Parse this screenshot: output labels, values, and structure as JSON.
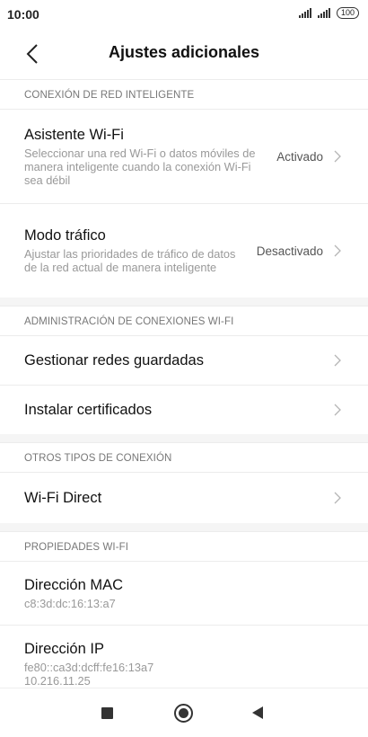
{
  "status_bar": {
    "time": "10:00",
    "battery": "100"
  },
  "header": {
    "title": "Ajustes adicionales"
  },
  "sections": {
    "smart": {
      "title": "CONEXIÓN DE RED INTELIGENTE",
      "wifi_assistant": {
        "title": "Asistente Wi-Fi",
        "subtitle": "Seleccionar una red Wi-Fi o datos móviles de manera inteligente cuando la conexión Wi-Fi sea débil",
        "value": "Activado"
      },
      "traffic_mode": {
        "title": "Modo tráfico",
        "subtitle": "Ajustar las prioridades de tráfico de datos de la red actual de manera inteligente",
        "value": "Desactivado"
      }
    },
    "wifi_admin": {
      "title": "ADMINISTRACIÓN DE CONEXIONES WI-FI",
      "saved_networks": "Gestionar redes guardadas",
      "install_certs": "Instalar certificados"
    },
    "other": {
      "title": "OTROS TIPOS DE CONEXIÓN",
      "wifi_direct": "Wi-Fi Direct"
    },
    "props": {
      "title": "PROPIEDADES WI-FI",
      "mac": {
        "title": "Dirección MAC",
        "value": "c8:3d:dc:16:13:a7"
      },
      "ip": {
        "title": "Dirección IP",
        "value1": "fe80::ca3d:dcff:fe16:13a7",
        "value2": "10.216.11.25"
      }
    }
  },
  "icons": {
    "back": "chevron-left-icon",
    "chevron": "chevron-right-icon",
    "nav_recents": "square-icon",
    "nav_home": "circle-icon",
    "nav_back": "triangle-icon"
  },
  "colors": {
    "chevron": "#b5b5b5",
    "section_text": "#777777",
    "subtitle": "#999999"
  }
}
